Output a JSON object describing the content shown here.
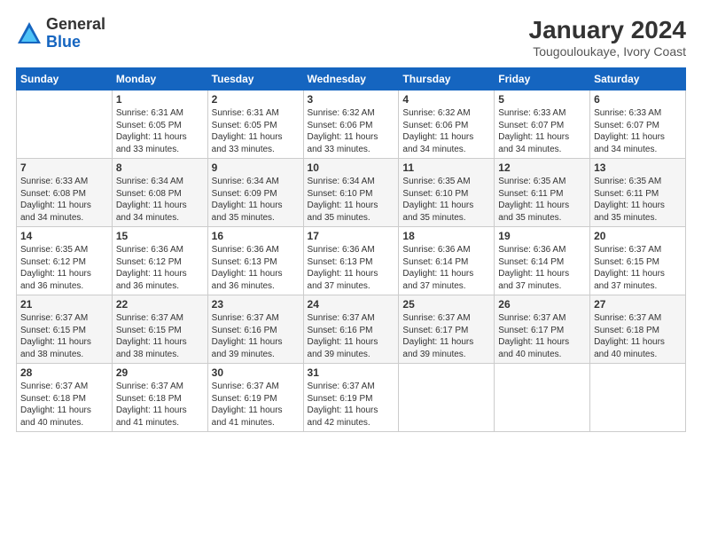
{
  "logo": {
    "general": "General",
    "blue": "Blue"
  },
  "title": "January 2024",
  "subtitle": "Tougouloukaye, Ivory Coast",
  "header": {
    "days": [
      "Sunday",
      "Monday",
      "Tuesday",
      "Wednesday",
      "Thursday",
      "Friday",
      "Saturday"
    ]
  },
  "weeks": [
    [
      {
        "day": "",
        "info": ""
      },
      {
        "day": "1",
        "info": "Sunrise: 6:31 AM\nSunset: 6:05 PM\nDaylight: 11 hours\nand 33 minutes."
      },
      {
        "day": "2",
        "info": "Sunrise: 6:31 AM\nSunset: 6:05 PM\nDaylight: 11 hours\nand 33 minutes."
      },
      {
        "day": "3",
        "info": "Sunrise: 6:32 AM\nSunset: 6:06 PM\nDaylight: 11 hours\nand 33 minutes."
      },
      {
        "day": "4",
        "info": "Sunrise: 6:32 AM\nSunset: 6:06 PM\nDaylight: 11 hours\nand 34 minutes."
      },
      {
        "day": "5",
        "info": "Sunrise: 6:33 AM\nSunset: 6:07 PM\nDaylight: 11 hours\nand 34 minutes."
      },
      {
        "day": "6",
        "info": "Sunrise: 6:33 AM\nSunset: 6:07 PM\nDaylight: 11 hours\nand 34 minutes."
      }
    ],
    [
      {
        "day": "7",
        "info": "Sunrise: 6:33 AM\nSunset: 6:08 PM\nDaylight: 11 hours\nand 34 minutes."
      },
      {
        "day": "8",
        "info": "Sunrise: 6:34 AM\nSunset: 6:08 PM\nDaylight: 11 hours\nand 34 minutes."
      },
      {
        "day": "9",
        "info": "Sunrise: 6:34 AM\nSunset: 6:09 PM\nDaylight: 11 hours\nand 35 minutes."
      },
      {
        "day": "10",
        "info": "Sunrise: 6:34 AM\nSunset: 6:10 PM\nDaylight: 11 hours\nand 35 minutes."
      },
      {
        "day": "11",
        "info": "Sunrise: 6:35 AM\nSunset: 6:10 PM\nDaylight: 11 hours\nand 35 minutes."
      },
      {
        "day": "12",
        "info": "Sunrise: 6:35 AM\nSunset: 6:11 PM\nDaylight: 11 hours\nand 35 minutes."
      },
      {
        "day": "13",
        "info": "Sunrise: 6:35 AM\nSunset: 6:11 PM\nDaylight: 11 hours\nand 35 minutes."
      }
    ],
    [
      {
        "day": "14",
        "info": "Sunrise: 6:35 AM\nSunset: 6:12 PM\nDaylight: 11 hours\nand 36 minutes."
      },
      {
        "day": "15",
        "info": "Sunrise: 6:36 AM\nSunset: 6:12 PM\nDaylight: 11 hours\nand 36 minutes."
      },
      {
        "day": "16",
        "info": "Sunrise: 6:36 AM\nSunset: 6:13 PM\nDaylight: 11 hours\nand 36 minutes."
      },
      {
        "day": "17",
        "info": "Sunrise: 6:36 AM\nSunset: 6:13 PM\nDaylight: 11 hours\nand 37 minutes."
      },
      {
        "day": "18",
        "info": "Sunrise: 6:36 AM\nSunset: 6:14 PM\nDaylight: 11 hours\nand 37 minutes."
      },
      {
        "day": "19",
        "info": "Sunrise: 6:36 AM\nSunset: 6:14 PM\nDaylight: 11 hours\nand 37 minutes."
      },
      {
        "day": "20",
        "info": "Sunrise: 6:37 AM\nSunset: 6:15 PM\nDaylight: 11 hours\nand 37 minutes."
      }
    ],
    [
      {
        "day": "21",
        "info": "Sunrise: 6:37 AM\nSunset: 6:15 PM\nDaylight: 11 hours\nand 38 minutes."
      },
      {
        "day": "22",
        "info": "Sunrise: 6:37 AM\nSunset: 6:15 PM\nDaylight: 11 hours\nand 38 minutes."
      },
      {
        "day": "23",
        "info": "Sunrise: 6:37 AM\nSunset: 6:16 PM\nDaylight: 11 hours\nand 39 minutes."
      },
      {
        "day": "24",
        "info": "Sunrise: 6:37 AM\nSunset: 6:16 PM\nDaylight: 11 hours\nand 39 minutes."
      },
      {
        "day": "25",
        "info": "Sunrise: 6:37 AM\nSunset: 6:17 PM\nDaylight: 11 hours\nand 39 minutes."
      },
      {
        "day": "26",
        "info": "Sunrise: 6:37 AM\nSunset: 6:17 PM\nDaylight: 11 hours\nand 40 minutes."
      },
      {
        "day": "27",
        "info": "Sunrise: 6:37 AM\nSunset: 6:18 PM\nDaylight: 11 hours\nand 40 minutes."
      }
    ],
    [
      {
        "day": "28",
        "info": "Sunrise: 6:37 AM\nSunset: 6:18 PM\nDaylight: 11 hours\nand 40 minutes."
      },
      {
        "day": "29",
        "info": "Sunrise: 6:37 AM\nSunset: 6:18 PM\nDaylight: 11 hours\nand 41 minutes."
      },
      {
        "day": "30",
        "info": "Sunrise: 6:37 AM\nSunset: 6:19 PM\nDaylight: 11 hours\nand 41 minutes."
      },
      {
        "day": "31",
        "info": "Sunrise: 6:37 AM\nSunset: 6:19 PM\nDaylight: 11 hours\nand 42 minutes."
      },
      {
        "day": "",
        "info": ""
      },
      {
        "day": "",
        "info": ""
      },
      {
        "day": "",
        "info": ""
      }
    ]
  ]
}
